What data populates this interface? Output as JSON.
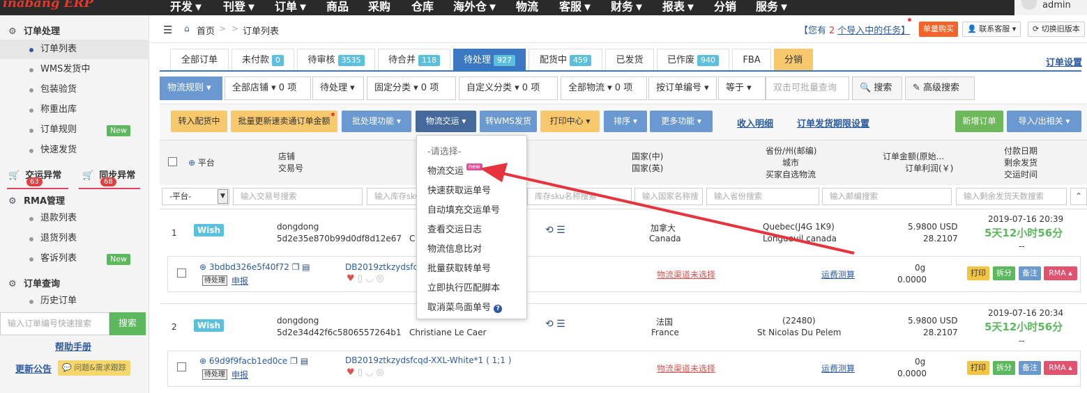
{
  "app": {
    "logo": "inabang ERP",
    "nav": [
      "开发 ▾",
      "刊登 ▾",
      "订单 ▾",
      "商品",
      "采购",
      "仓库",
      "海外仓 ▾",
      "物流",
      "客服 ▾",
      "财务 ▾",
      "报表 ▾",
      "分销",
      "服务 ▾"
    ],
    "user": "admin"
  },
  "sidebar": {
    "order_section": "订单处理",
    "order_items": [
      "订单列表",
      "WMS发货中",
      "包装验货",
      "称重出库",
      "订单规则",
      "快速发货"
    ],
    "new_label": "New",
    "exc1": "交运异常",
    "exc1_count": "63",
    "exc2": "同步异常",
    "exc2_count": "68",
    "rma_section": "RMA管理",
    "rma_items": [
      "退款列表",
      "退货列表",
      "客诉列表"
    ],
    "query_section": "订单查询",
    "query_items": [
      "历史订单"
    ],
    "search_placeholder": "输入订单编号快速搜索",
    "search_btn": "搜索",
    "help": "帮助手册",
    "notice": "更新公告",
    "feedback": "问题&需求跟踪"
  },
  "breadcrumb": {
    "home": "首页",
    "sep": ">",
    "current": "订单列表"
  },
  "header_right": {
    "import_pre": "【您有",
    "import_count": "2",
    "import_post": "个导入中的任务】",
    "buy": "单量购买",
    "support": "联系客服 ▾",
    "old": "切换旧版本"
  },
  "tabs": [
    {
      "label": "全部订单",
      "count": ""
    },
    {
      "label": "未付款",
      "count": "0"
    },
    {
      "label": "待审核",
      "count": "3535"
    },
    {
      "label": "待合并",
      "count": "118"
    },
    {
      "label": "待处理",
      "count": "927"
    },
    {
      "label": "配货中",
      "count": "459"
    },
    {
      "label": "已发货",
      "count": ""
    },
    {
      "label": "已作废",
      "count": "940"
    },
    {
      "label": "FBA",
      "count": ""
    },
    {
      "label": "分销",
      "count": ""
    }
  ],
  "order_settings": "订单设置",
  "filters": {
    "rule": "物流规则 ▾",
    "store": "全部店铺 ▾  0 项",
    "status": "待处理 ▾",
    "fixed": "固定分类 ▾   0 项",
    "custom": "自定义分类 ▾   0 项",
    "logistics": "全部物流 ▾  0 项",
    "by_order": "按订单编号 ▾",
    "equal": "等于 ▾",
    "query_placeholder": "双击可批量查询",
    "search": "搜索",
    "advanced": "高级搜索"
  },
  "actions": {
    "to_picking": "转入配货中",
    "batch_update": "批量更新速卖通订单金额",
    "batch": "批处理功能 ▾",
    "logistics_ship": "物流交运 ▾",
    "to_wms": "转WMS发货",
    "print": "打印中心 ▾",
    "sort": "排序 ▾",
    "more": "更多功能 ▾",
    "income": "收入明细",
    "deadline": "订单发货期限设置",
    "new_order": "新增订单",
    "import_export": "导入/出相关 ▾"
  },
  "table_header": {
    "platform": "平台",
    "store": "店铺",
    "trade_no": "交易号",
    "country_cn": "国家(中)",
    "country_en": "国家(英)",
    "province": "省份/州(邮编)",
    "city": "城市",
    "buyer_logistics": "买家自选物流",
    "amount": "订单金额(原始...",
    "profit": "订单利润(￥)",
    "pay_date": "付款日期",
    "remain": "剩余发货",
    "ship_time": "交运时间"
  },
  "filter_inputs": {
    "platform": "-平台-",
    "trade": "输入交易号搜索",
    "stock_sku": "输入库存sku",
    "stock_sku2": "库存sku名称搜索",
    "country": "输入国家名称搜",
    "province": "输入省份搜索",
    "zip": "输入邮编搜索",
    "remain": "输入剩余发货天数搜索"
  },
  "orders": [
    {
      "idx": "1",
      "platform": "Wish",
      "store": "dongdong",
      "trade": "5d2e35e870b99d0df8d12e67",
      "buyer": "C",
      "country_cn": "加拿大",
      "country_en": "Canada",
      "province": "Quebec(J4G 1K9)",
      "city": "Longueuil canada",
      "amount": "5.9800 USD",
      "profit": "28.2107",
      "pay_date": "2019-07-16 20:39",
      "remain": "5天12小时56分",
      "ship": "--",
      "order_no": "3bdbd326e5f40f72",
      "status_tag": "待处理",
      "declare": "申报",
      "sku": "DB2019ztkzydsfcqd",
      "weight": "0g",
      "fee": "0.0000",
      "channel": "物流渠道未选择",
      "calc": "运费测算"
    },
    {
      "idx": "2",
      "platform": "Wish",
      "store": "dongdong",
      "trade": "5d2e34d42f6c5806557264b1",
      "buyer": "Christiane Le Caer",
      "country_cn": "法国",
      "country_en": "France",
      "province": "(22480)",
      "city": "St Nicolas Du Pelem",
      "amount": "5.9800 USD",
      "profit": "28.2107",
      "pay_date": "2019-07-16 20:34",
      "remain": "5天12小时56分",
      "ship": "--",
      "order_no": "69d9f9facb1ed0ce",
      "status_tag": "待处理",
      "declare": "申报",
      "sku": "DB2019ztkzydsfcqd-XXL-White*1 ( 1;1 )",
      "weight": "0g",
      "fee": "0.0000",
      "channel": "物流渠道未选择",
      "calc": "运费测算"
    }
  ],
  "row_buttons": {
    "print": "打印",
    "split": "拆分",
    "note": "备注",
    "rma": "RMA ▴"
  },
  "dropdown": {
    "placeholder": "-请选择-",
    "items": [
      "物流交运",
      "快速获取运单号",
      "自动填充交运单号",
      "查看交运日志",
      "物流信息比对",
      "批量获取转单号",
      "立即执行匹配脚本",
      "取消菜鸟面单号"
    ],
    "new_tag": "new"
  }
}
